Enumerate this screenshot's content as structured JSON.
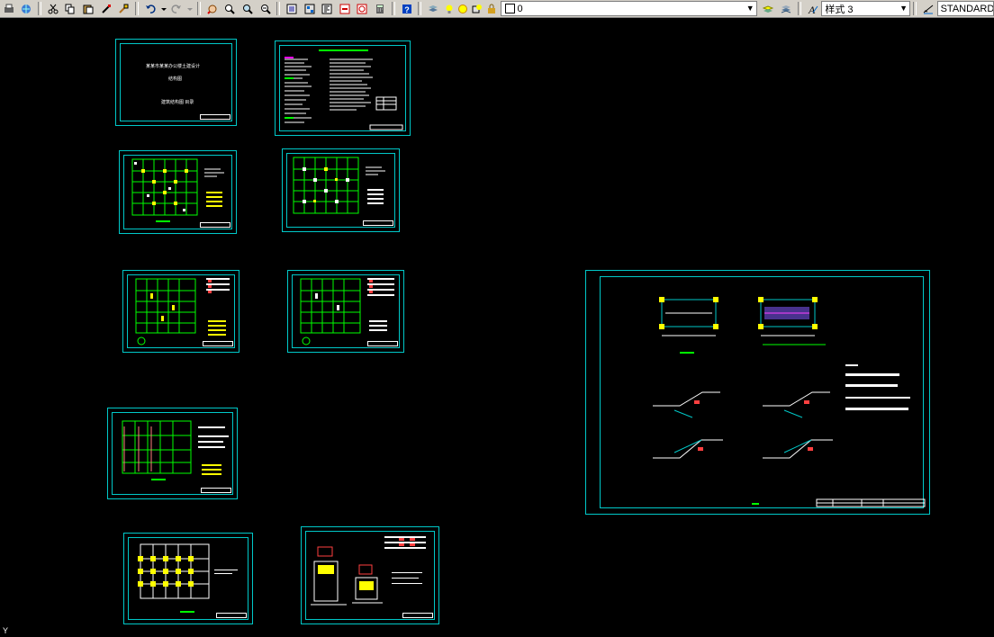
{
  "toolbar": {
    "layer_value": "0",
    "text_style_value": "样式 3",
    "dim_style_value": "STANDARD"
  },
  "drawing": {
    "sheet1_title": "某某市某某办公楼土建设计",
    "sheet1_subtitle": "结构图",
    "sheet1_line3": "建筑结构图 目录"
  },
  "colors": {
    "background": "#000000",
    "sheet_border": "#00c8c8",
    "grid_green": "#00ff00",
    "column_yellow": "#ffff00",
    "text_white": "#ffffff"
  }
}
